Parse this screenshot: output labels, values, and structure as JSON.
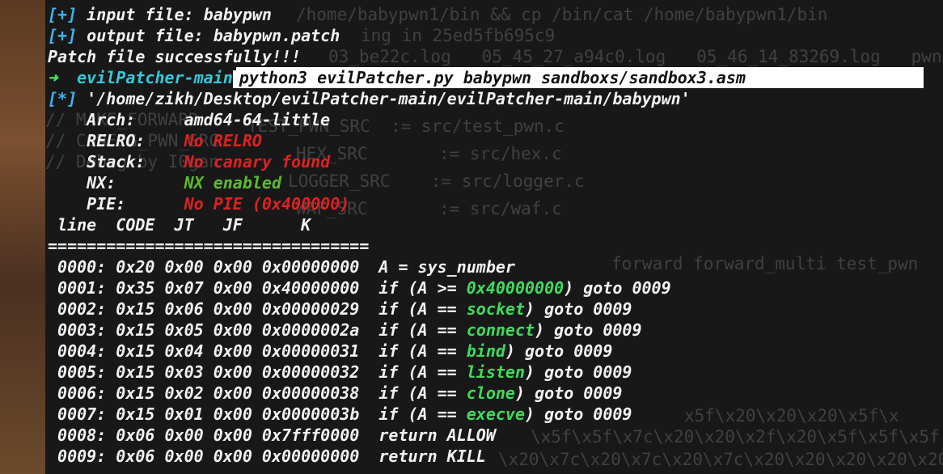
{
  "ghost_text": [
    "/home/babypwn1/bin && cp /bin/cat /home/babypwn1/bin",
    "ing in 25ed5fb695c9",
    "03_be22c.log   05_45_27_a94c0.log   05_46_14_83269.log   pwn",
    "// MAKE_FORWARD",
    "// CONFIG_PWN_SRC",
    "// Debug by I0gan",
    "TEST_PWN_SRC  := src/test_pwn.c",
    "HEX_SRC       := src/hex.c",
    "LOGGER_SRC    := src/logger.c",
    "WAF_SRC       := src/waf.c",
    "forward forward_multi test_pwn",
    "x5f\\x20\\x20\\x20\\x5f\\x",
    "\\x5f\\x5f\\x7c\\x20\\x20\\x2f\\x20\\x5f\\x5f\\x5f",
    "\\x20\\x7c\\x20\\x7c\\x20\\x7c\\x20\\x20\\x20\\x20\\x20"
  ],
  "term": {
    "input_file_prefix": "[+]",
    "input_file_text": " input file: babypwn",
    "output_file_prefix": "[+]",
    "output_file_text": " output file: babypwn.patch",
    "patch_msg": "Patch file successfully!!!",
    "prompt_arrow": "➜",
    "prompt_dir": "evilPatcher-main",
    "command": "python3 evilPatcher.py babypwn sandboxs/sandbox3.asm",
    "path_prefix": "[*]",
    "path_text": " '/home/zikh/Desktop/evilPatcher-main/evilPatcher-main/babypwn'",
    "arch_label": "    Arch:     ",
    "arch_value": "amd64-64-little",
    "relro_label": "    RELRO:    ",
    "relro_value": "No RELRO",
    "stack_label": "    Stack:    ",
    "stack_value": "No canary found",
    "nx_label": "    NX:       ",
    "nx_value": "NX enabled",
    "pie_label": "    PIE:      ",
    "pie_value": "No PIE (0x400000)",
    "table_header": " line  CODE  JT   JF      K",
    "separator": "================================="
  },
  "rules": [
    {
      "head": " 0000: 0x20 0x00 0x00 0x00000000  A = sys_number",
      "pre": "",
      "kw": "",
      "post": ""
    },
    {
      "head": " 0001: 0x35 0x07 0x00 0x40000000  if (A >= ",
      "pre": "",
      "kw": "0x40000000",
      "post": ") goto 0009"
    },
    {
      "head": " 0002: 0x15 0x06 0x00 0x00000029  if (A == ",
      "pre": "",
      "kw": "socket",
      "post": ") goto 0009"
    },
    {
      "head": " 0003: 0x15 0x05 0x00 0x0000002a  if (A == ",
      "pre": "",
      "kw": "connect",
      "post": ") goto 0009"
    },
    {
      "head": " 0004: 0x15 0x04 0x00 0x00000031  if (A == ",
      "pre": "",
      "kw": "bind",
      "post": ") goto 0009"
    },
    {
      "head": " 0005: 0x15 0x03 0x00 0x00000032  if (A == ",
      "pre": "",
      "kw": "listen",
      "post": ") goto 0009"
    },
    {
      "head": " 0006: 0x15 0x02 0x00 0x00000038  if (A == ",
      "pre": "",
      "kw": "clone",
      "post": ") goto 0009"
    },
    {
      "head": " 0007: 0x15 0x01 0x00 0x0000003b  if (A == ",
      "pre": "",
      "kw": "execve",
      "post": ") goto 0009"
    },
    {
      "head": " 0008: 0x06 0x00 0x00 0x7fff0000  return ALLOW",
      "pre": "",
      "kw": "",
      "post": ""
    },
    {
      "head": " 0009: 0x06 0x00 0x00 0x00000000  return KILL",
      "pre": "",
      "kw": "",
      "post": ""
    }
  ],
  "colors": {
    "terminal_bg": "#181818",
    "accent_blue": "#3fb4f0",
    "accent_green": "#3ddc5c",
    "warning_red": "#e02020"
  }
}
